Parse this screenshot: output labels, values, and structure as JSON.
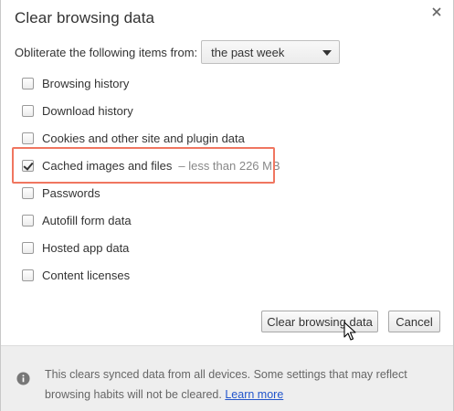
{
  "dialog": {
    "title": "Clear browsing data",
    "close_icon": "close-icon"
  },
  "time_range": {
    "label": "Obliterate the following items from:",
    "selected": "the past week"
  },
  "items": [
    {
      "label": "Browsing history",
      "checked": false,
      "sub": ""
    },
    {
      "label": "Download history",
      "checked": false,
      "sub": ""
    },
    {
      "label": "Cookies and other site and plugin data",
      "checked": false,
      "sub": ""
    },
    {
      "label": "Cached images and files",
      "checked": true,
      "sub": "–  less than 226 MB"
    },
    {
      "label": "Passwords",
      "checked": false,
      "sub": ""
    },
    {
      "label": "Autofill form data",
      "checked": false,
      "sub": ""
    },
    {
      "label": "Hosted app data",
      "checked": false,
      "sub": ""
    },
    {
      "label": "Content licenses",
      "checked": false,
      "sub": ""
    }
  ],
  "buttons": {
    "clear_label": "Clear browsing data",
    "cancel_label": "Cancel"
  },
  "footer": {
    "text": "This clears synced data from all devices. Some settings that may reflect browsing habits will not be cleared.",
    "link_label": "Learn more"
  },
  "colors": {
    "highlight": "#f07660",
    "link": "#2255cc",
    "footer_bg": "#eeeeee"
  }
}
